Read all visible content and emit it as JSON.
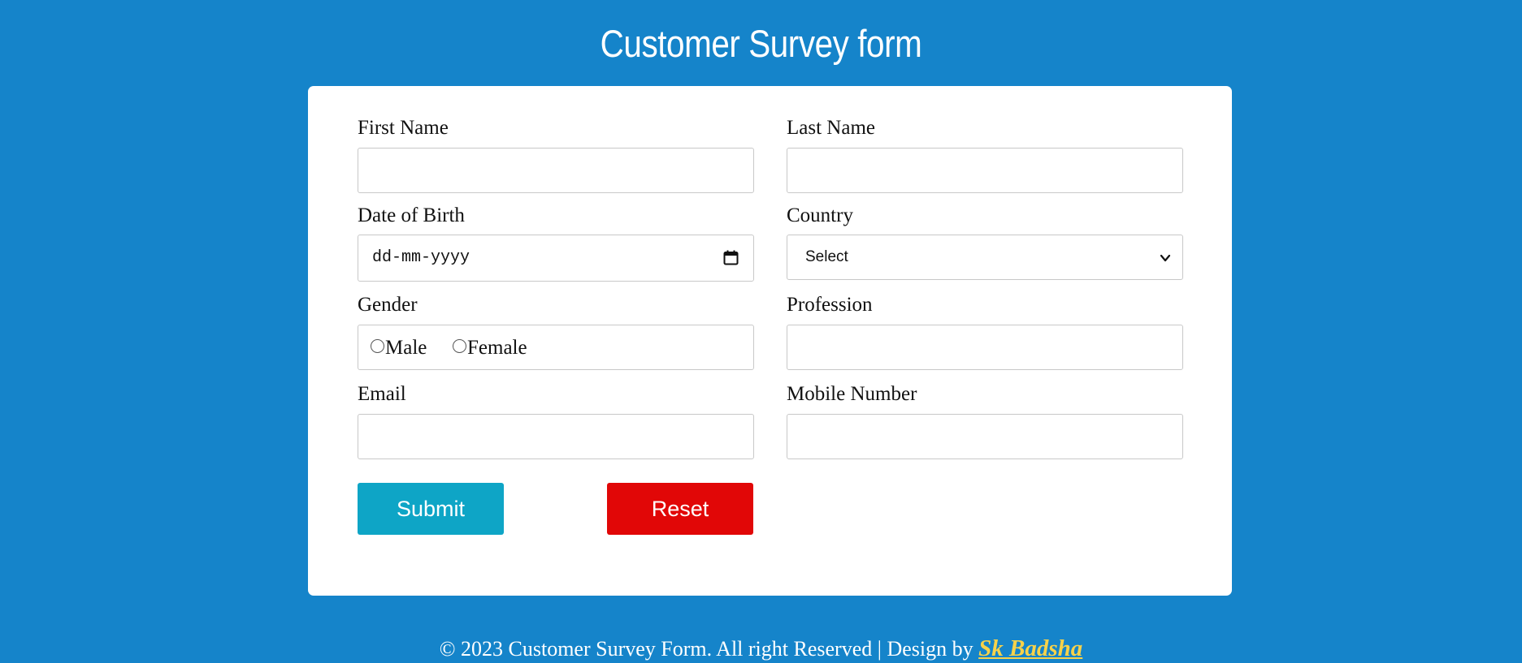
{
  "page": {
    "title": "Customer Survey form",
    "background_color": "#1584ca"
  },
  "form": {
    "first_name": {
      "label": "First Name",
      "value": ""
    },
    "last_name": {
      "label": "Last Name",
      "value": ""
    },
    "dob": {
      "label": "Date of Birth",
      "placeholder": "dd-mm-yyyy",
      "icon": "calendar-icon"
    },
    "country": {
      "label": "Country",
      "selected": "Select",
      "icon": "chevron-down-icon"
    },
    "gender": {
      "label": "Gender",
      "options": [
        "Male",
        "Female"
      ]
    },
    "profession": {
      "label": "Profession",
      "value": ""
    },
    "email": {
      "label": "Email",
      "value": ""
    },
    "mobile": {
      "label": "Mobile Number",
      "value": ""
    }
  },
  "buttons": {
    "submit": {
      "label": "Submit",
      "color": "#0ea5c6"
    },
    "reset": {
      "label": "Reset",
      "color": "#e10707"
    }
  },
  "footer": {
    "text": "© 2023 Customer Survey Form. All right Reserved | Design by ",
    "author": "Sk Badsha",
    "author_color": "#f7d24a"
  }
}
